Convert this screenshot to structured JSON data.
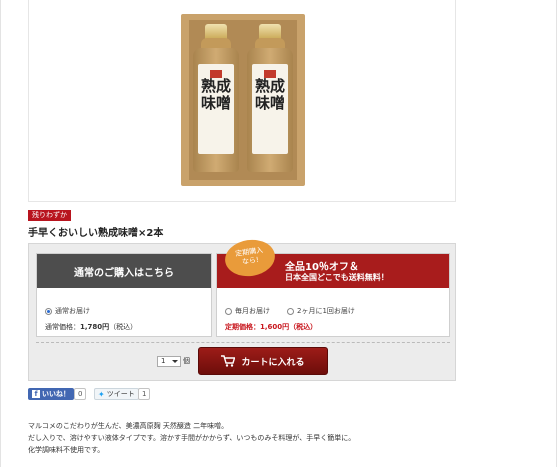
{
  "product": {
    "badge": "残りわずか",
    "title": "手早くおいしい熟成味噌×2本",
    "bottle_label": "熟成 味噌"
  },
  "purchase": {
    "normal": {
      "heading": "通常のご購入はこちら",
      "option_label": "通常お届け",
      "price_label": "通常価格：",
      "price_value": "1,780円",
      "tax_note": "（税込）"
    },
    "regular": {
      "burst_line1": "定期購入",
      "burst_line2": "なら!",
      "heading_line1": "全品10％オフ＆",
      "heading_line2": "日本全国どこでも送料無料！",
      "option1": "毎月お届け",
      "option2": "2ヶ月に1回お届け",
      "price_label": "定期価格：",
      "price_value": "1,600円",
      "tax_note": "（税込）"
    },
    "quantity": {
      "value": "1",
      "unit": "個"
    },
    "cart_button": "カートに入れる"
  },
  "social": {
    "like_label": "いいね！",
    "like_count": "0",
    "tweet_label": "ツイート",
    "tweet_count": "1"
  },
  "description": [
    "マルコメのこだわりが生んだ、美濃高原麹 天然醸造 二年味噌。",
    "だし入りで、溶けやすい液体タイプです。溶かす手間がかからず、いつものみそ料理が、手早く簡単に。",
    "化学調味料不使用です。"
  ],
  "colors": {
    "accent_red": "#a81c1c",
    "dark_header": "#4d4d4d",
    "cart_button": "#7d1310",
    "burst_orange": "#e99b3a",
    "facebook": "#4267b2"
  }
}
